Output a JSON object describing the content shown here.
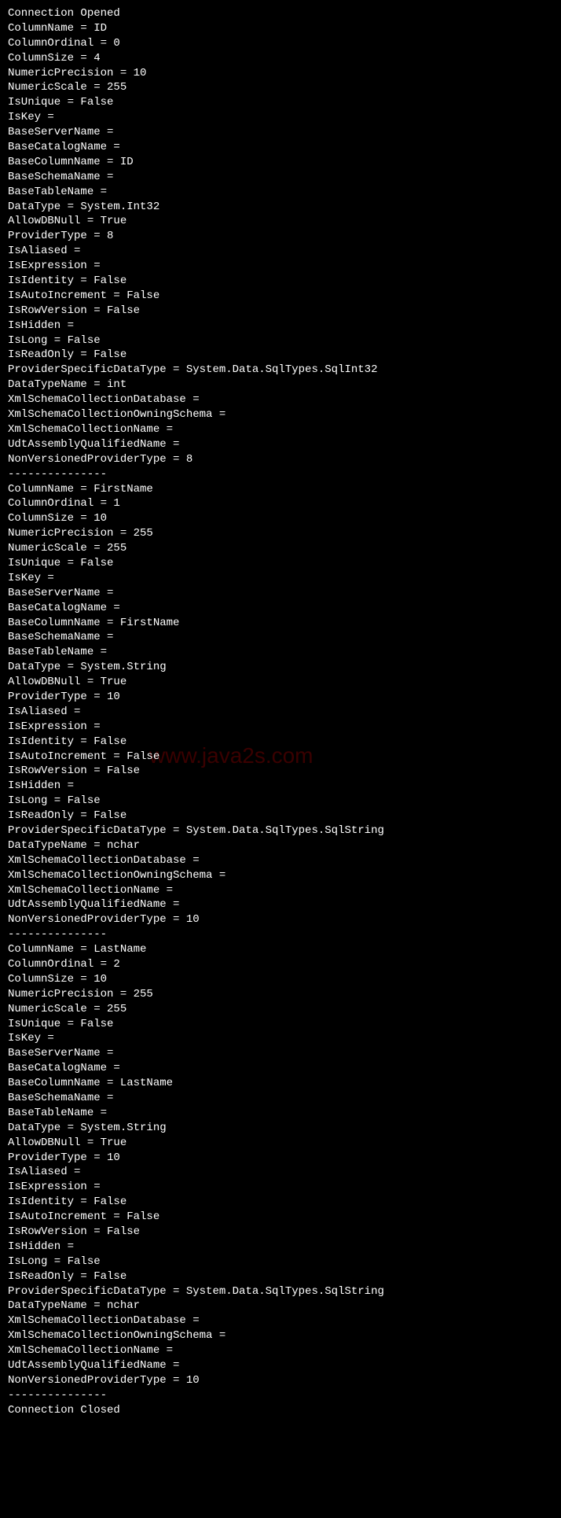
{
  "watermark": "www.java2s.com",
  "header": "Connection Opened",
  "divider": "---------------",
  "footer": "Connection Closed",
  "columns": [
    {
      "ColumnName": "ID",
      "ColumnOrdinal": "0",
      "ColumnSize": "4",
      "NumericPrecision": "10",
      "NumericScale": "255",
      "IsUnique": "False",
      "IsKey": "",
      "BaseServerName": "",
      "BaseCatalogName": "",
      "BaseColumnName": "ID",
      "BaseSchemaName": "",
      "BaseTableName": "",
      "DataType": "System.Int32",
      "AllowDBNull": "True",
      "ProviderType": "8",
      "IsAliased": "",
      "IsExpression": "",
      "IsIdentity": "False",
      "IsAutoIncrement": "False",
      "IsRowVersion": "False",
      "IsHidden": "",
      "IsLong": "False",
      "IsReadOnly": "False",
      "ProviderSpecificDataType": "System.Data.SqlTypes.SqlInt32",
      "DataTypeName": "int",
      "XmlSchemaCollectionDatabase": "",
      "XmlSchemaCollectionOwningSchema": "",
      "XmlSchemaCollectionName": "",
      "UdtAssemblyQualifiedName": "",
      "NonVersionedProviderType": "8"
    },
    {
      "ColumnName": "FirstName",
      "ColumnOrdinal": "1",
      "ColumnSize": "10",
      "NumericPrecision": "255",
      "NumericScale": "255",
      "IsUnique": "False",
      "IsKey": "",
      "BaseServerName": "",
      "BaseCatalogName": "",
      "BaseColumnName": "FirstName",
      "BaseSchemaName": "",
      "BaseTableName": "",
      "DataType": "System.String",
      "AllowDBNull": "True",
      "ProviderType": "10",
      "IsAliased": "",
      "IsExpression": "",
      "IsIdentity": "False",
      "IsAutoIncrement": "False",
      "IsRowVersion": "False",
      "IsHidden": "",
      "IsLong": "False",
      "IsReadOnly": "False",
      "ProviderSpecificDataType": "System.Data.SqlTypes.SqlString",
      "DataTypeName": "nchar",
      "XmlSchemaCollectionDatabase": "",
      "XmlSchemaCollectionOwningSchema": "",
      "XmlSchemaCollectionName": "",
      "UdtAssemblyQualifiedName": "",
      "NonVersionedProviderType": "10"
    },
    {
      "ColumnName": "LastName",
      "ColumnOrdinal": "2",
      "ColumnSize": "10",
      "NumericPrecision": "255",
      "NumericScale": "255",
      "IsUnique": "False",
      "IsKey": "",
      "BaseServerName": "",
      "BaseCatalogName": "",
      "BaseColumnName": "LastName",
      "BaseSchemaName": "",
      "BaseTableName": "",
      "DataType": "System.String",
      "AllowDBNull": "True",
      "ProviderType": "10",
      "IsAliased": "",
      "IsExpression": "",
      "IsIdentity": "False",
      "IsAutoIncrement": "False",
      "IsRowVersion": "False",
      "IsHidden": "",
      "IsLong": "False",
      "IsReadOnly": "False",
      "ProviderSpecificDataType": "System.Data.SqlTypes.SqlString",
      "DataTypeName": "nchar",
      "XmlSchemaCollectionDatabase": "",
      "XmlSchemaCollectionOwningSchema": "",
      "XmlSchemaCollectionName": "",
      "UdtAssemblyQualifiedName": "",
      "NonVersionedProviderType": "10"
    }
  ],
  "propertyOrder": [
    "ColumnName",
    "ColumnOrdinal",
    "ColumnSize",
    "NumericPrecision",
    "NumericScale",
    "IsUnique",
    "IsKey",
    "BaseServerName",
    "BaseCatalogName",
    "BaseColumnName",
    "BaseSchemaName",
    "BaseTableName",
    "DataType",
    "AllowDBNull",
    "ProviderType",
    "IsAliased",
    "IsExpression",
    "IsIdentity",
    "IsAutoIncrement",
    "IsRowVersion",
    "IsHidden",
    "IsLong",
    "IsReadOnly",
    "ProviderSpecificDataType",
    "DataTypeName",
    "XmlSchemaCollectionDatabase",
    "XmlSchemaCollectionOwningSchema",
    "XmlSchemaCollectionName",
    "UdtAssemblyQualifiedName",
    "NonVersionedProviderType"
  ]
}
